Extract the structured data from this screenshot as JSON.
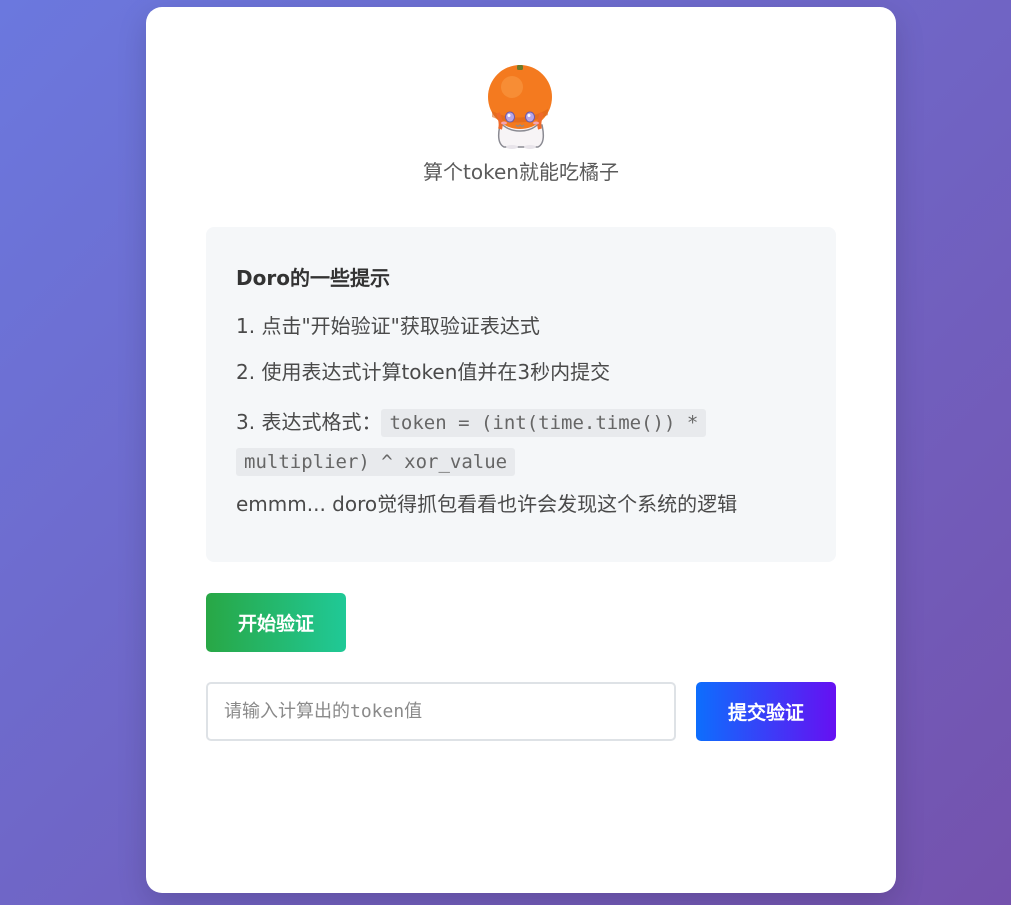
{
  "header": {
    "avatar_icon": "orange-headed-chibi-avatar",
    "subtitle": "算个token就能吃橘子"
  },
  "tips": {
    "title": "Doro的一些提示",
    "step1": "1. 点击\"开始验证\"获取验证表达式",
    "step2": "2. 使用表达式计算token值并在3秒内提交",
    "step3_prefix": "3. 表达式格式：",
    "step3_code_line1": "token = (int(time.time()) *",
    "step3_code_line2": "multiplier) ^ xor_value",
    "note": "emmm... doro觉得抓包看看也许会发现这个系统的逻辑"
  },
  "actions": {
    "start_label": "开始验证",
    "submit_label": "提交验证"
  },
  "token_input": {
    "placeholder": "请输入计算出的token值",
    "value": ""
  },
  "colors": {
    "background_start": "#6b78de",
    "background_end": "#7452ad",
    "start_button_start": "#28a745",
    "start_button_end": "#20c997",
    "submit_button_start": "#0d6efd",
    "submit_button_end": "#6610f2"
  }
}
